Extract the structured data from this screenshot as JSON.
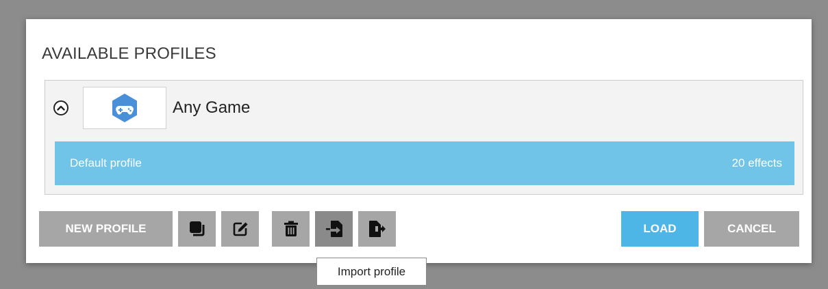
{
  "dialog": {
    "title": "AVAILABLE PROFILES"
  },
  "game": {
    "name": "Any Game",
    "icon": "gamepad-icon",
    "accent_color": "#4a90d9"
  },
  "profiles": [
    {
      "name": "Default profile",
      "effects": "20 effects",
      "selected": true,
      "color": "#6fc4e8"
    }
  ],
  "toolbar": {
    "new_profile_label": "NEW PROFILE",
    "icons": [
      "duplicate-icon",
      "edit-icon",
      "trash-icon",
      "import-icon",
      "export-icon"
    ]
  },
  "actions": {
    "load_label": "LOAD",
    "cancel_label": "CANCEL"
  },
  "tooltip": {
    "text": "Import profile"
  }
}
